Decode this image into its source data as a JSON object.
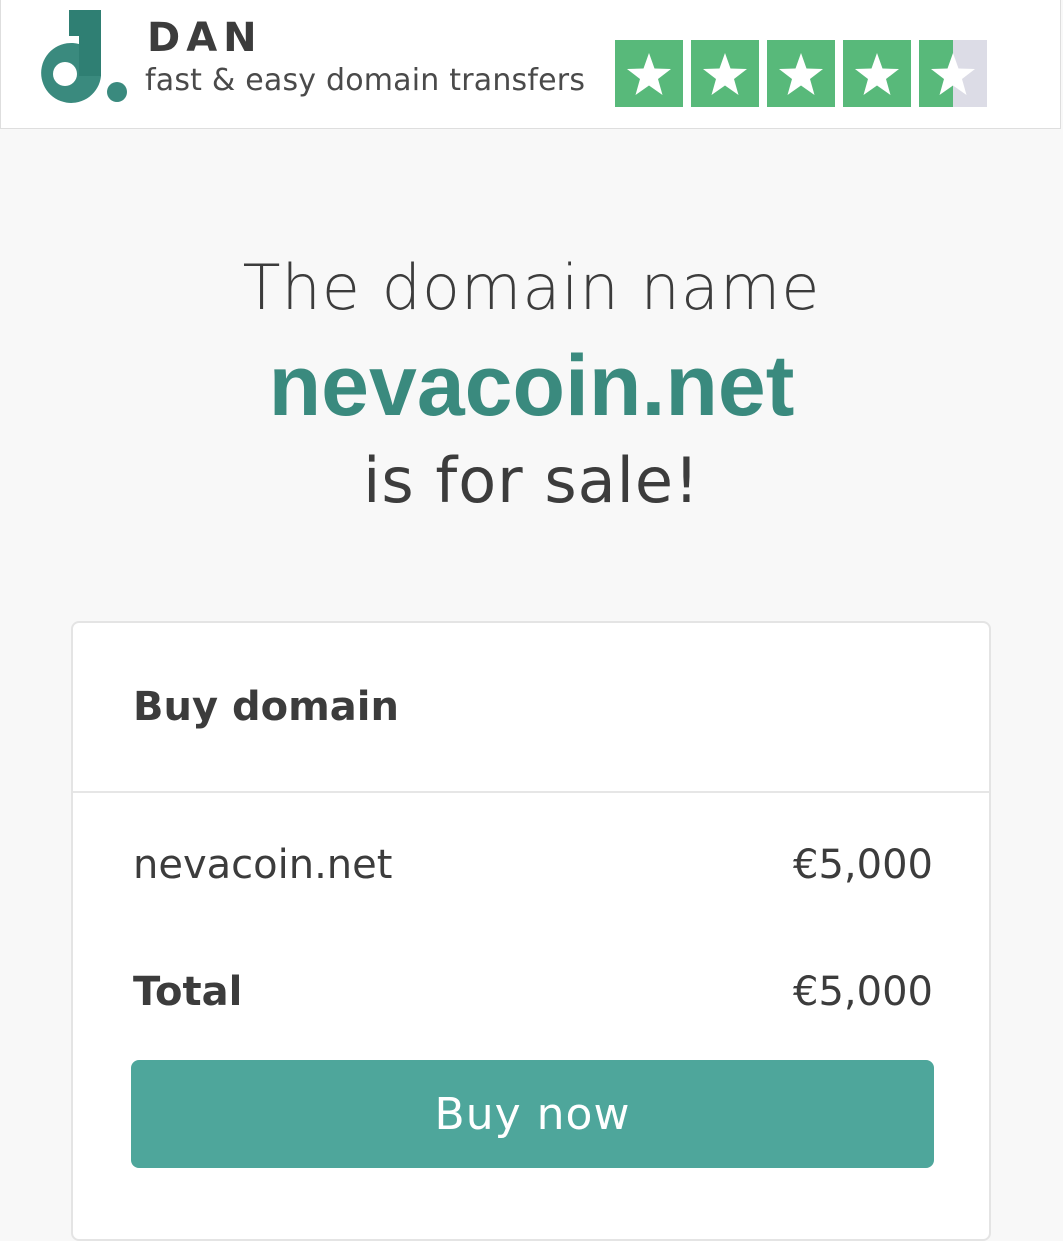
{
  "header": {
    "brand_name": "DAN",
    "tagline": "fast & easy domain transfers",
    "logo_icon": "dan-logo-icon",
    "rating": {
      "stars_filled": 4.5,
      "stars_total": 5,
      "filled_color": "#58b97a",
      "empty_color": "#dcdce6"
    }
  },
  "headline": {
    "line1": "The domain name",
    "domain": "nevacoin.net",
    "line3": "is for sale!"
  },
  "card": {
    "title": "Buy domain",
    "item_label": "nevacoin.net",
    "item_price": "€5,000",
    "total_label": "Total",
    "total_price": "€5,000",
    "buy_button_label": "Buy now"
  },
  "colors": {
    "accent": "#3a8a7e",
    "button": "#4ea69b"
  }
}
